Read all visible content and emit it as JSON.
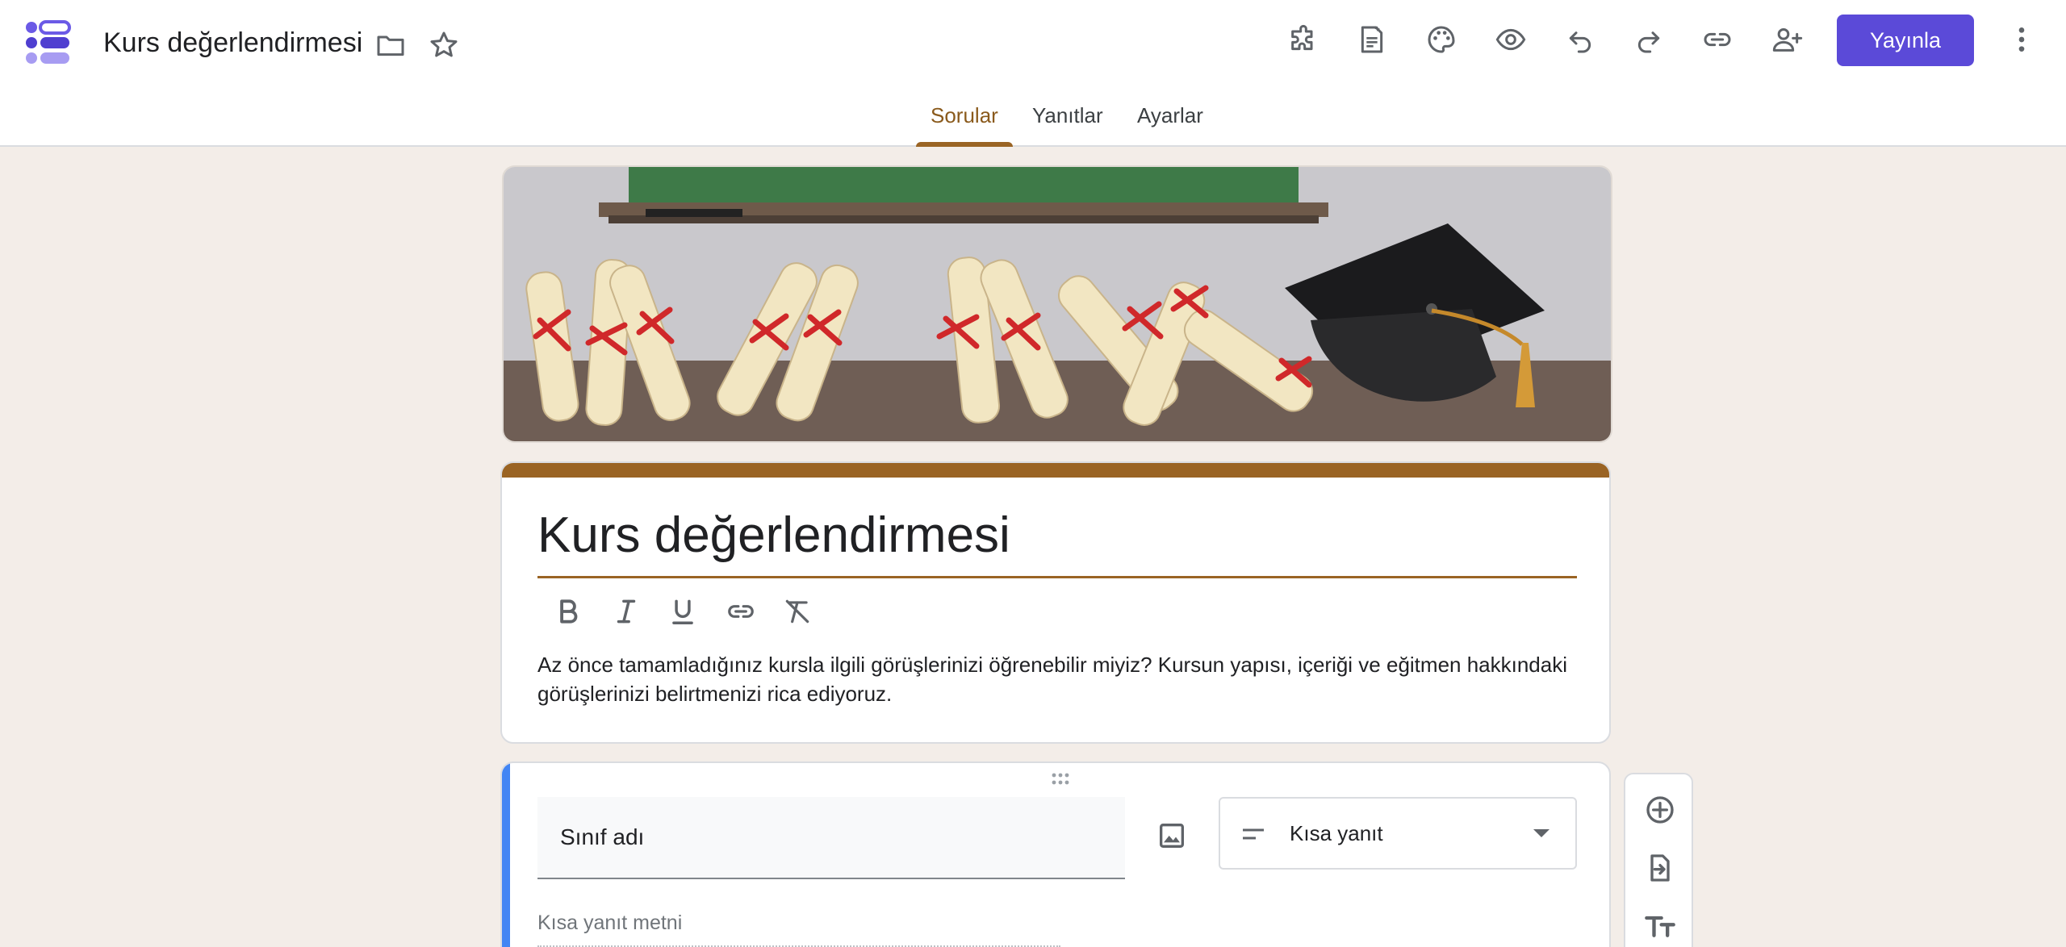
{
  "header": {
    "doc_title": "Kurs değerlendirmesi",
    "publish_label": "Yayınla",
    "icons": [
      "forms-logo-icon",
      "folder-icon",
      "star-icon",
      "addons-icon",
      "ai-form-icon",
      "palette-icon",
      "preview-eye-icon",
      "undo-icon",
      "redo-icon",
      "link-icon",
      "add-collaborator-icon",
      "more-vert-icon"
    ]
  },
  "tabs": [
    {
      "label": "Sorular",
      "active": true
    },
    {
      "label": "Yanıtlar",
      "active": false
    },
    {
      "label": "Ayarlar",
      "active": false
    }
  ],
  "form": {
    "title": "Kurs değerlendirmesi",
    "description": "Az önce tamamladığınız kursla ilgili görüşlerinizi öğrenebilir miyiz? Kursun yapısı, içeriği ve eğitmen hakkındaki görüşlerinizi belirtmenizi rica ediyoruz.",
    "format_icons": [
      "bold-icon",
      "italic-icon",
      "underline-icon",
      "link-icon",
      "clear-format-icon"
    ]
  },
  "question": {
    "title": "Sınıf adı",
    "type": "Kısa yanıt",
    "answer_placeholder": "Kısa yanıt metni"
  },
  "side_toolbar": [
    "add-question-icon",
    "import-questions-icon",
    "add-title-icon"
  ],
  "colors": {
    "accent": "#9a6424",
    "publish": "#5b4ad8",
    "question_accent": "#4285f4",
    "background": "#f3ede8"
  }
}
